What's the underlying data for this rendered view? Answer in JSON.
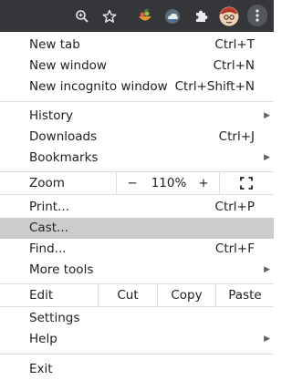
{
  "colors": {
    "toolbar_bg": "#35363a",
    "menu_bg": "#ffffff",
    "highlight": "#cccccc",
    "separator": "#dadce0",
    "text": "#202124"
  },
  "toolbar": {
    "icons": [
      "zoom-icon",
      "bookmark-star-icon",
      "extension-fruit-bowl-icon",
      "extension-cloud-icon",
      "extensions-puzzle-icon",
      "profile-avatar",
      "more-menu-icon"
    ]
  },
  "menu": {
    "new_tab": {
      "label": "New tab",
      "shortcut": "Ctrl+T"
    },
    "new_window": {
      "label": "New window",
      "shortcut": "Ctrl+N"
    },
    "new_incognito": {
      "label": "New incognito window",
      "shortcut": "Ctrl+Shift+N"
    },
    "history": {
      "label": "History"
    },
    "downloads": {
      "label": "Downloads",
      "shortcut": "Ctrl+J"
    },
    "bookmarks": {
      "label": "Bookmarks"
    },
    "zoom": {
      "label": "Zoom",
      "minus": "−",
      "value": "110%",
      "plus": "+"
    },
    "print": {
      "label": "Print...",
      "shortcut": "Ctrl+P"
    },
    "cast": {
      "label": "Cast...",
      "highlighted": true
    },
    "find": {
      "label": "Find...",
      "shortcut": "Ctrl+F"
    },
    "more_tools": {
      "label": "More tools"
    },
    "edit": {
      "label": "Edit",
      "cut": "Cut",
      "copy": "Copy",
      "paste": "Paste"
    },
    "settings": {
      "label": "Settings"
    },
    "help": {
      "label": "Help"
    },
    "exit": {
      "label": "Exit"
    }
  }
}
